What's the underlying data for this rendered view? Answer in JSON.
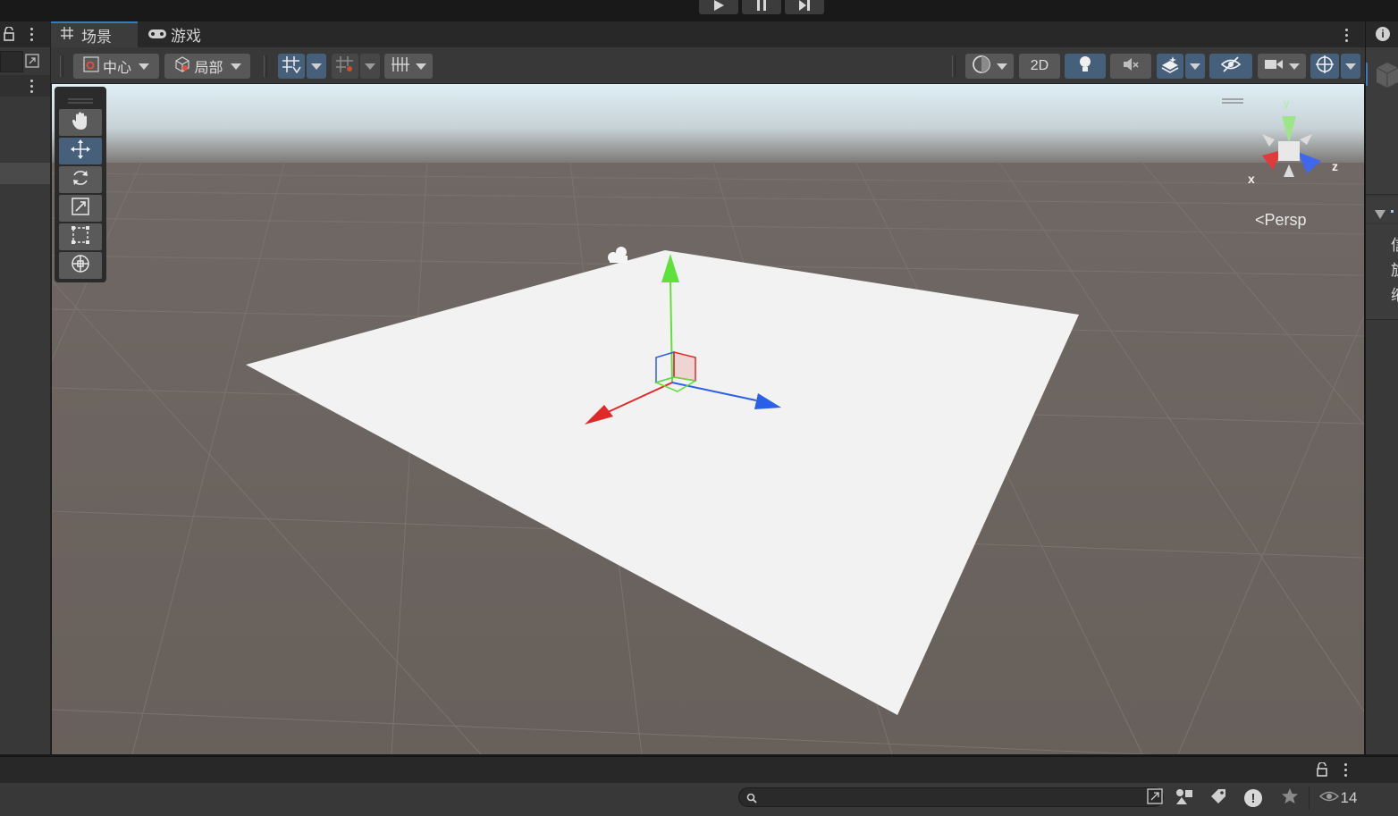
{
  "window": {
    "play_controls": [
      "play-icon",
      "pause-icon",
      "step-icon"
    ]
  },
  "tabs": [
    {
      "label": "场景",
      "icon": "scene-grid-icon",
      "active": true
    },
    {
      "label": "游戏",
      "icon": "gamepad-icon",
      "active": false
    }
  ],
  "toolbar": {
    "pivot_label": "中心",
    "space_label": "局部",
    "twod_label": "2D",
    "icons": [
      "pivot-icon",
      "local-space-icon",
      "grid-snap-icon",
      "increment-snap-icon",
      "grid-visibility-icon",
      "shading-mode-icon",
      "lighting-icon",
      "audio-mute-icon",
      "effects-icon",
      "scene-visibility-icon",
      "camera-icon",
      "gizmos-icon"
    ]
  },
  "tools": [
    "hand-tool-icon",
    "move-tool-icon",
    "rotate-tool-icon",
    "scale-tool-icon",
    "rect-tool-icon",
    "transform-tool-icon"
  ],
  "viewport": {
    "projection_label": "Persp",
    "axis_labels": {
      "x": "x",
      "y": "y",
      "z": "z"
    },
    "colors": {
      "x_axis": "#e02a2a",
      "y_axis": "#5fe03a",
      "z_axis": "#2a5fe8",
      "ground": "#67605b",
      "plane": "#f2f2f2",
      "sky": "#dfeff6"
    }
  },
  "right_panel": {
    "chars": [
      "信",
      "旋",
      "缩"
    ]
  },
  "bottom": {
    "search_placeholder": "",
    "visibility_count": "14"
  }
}
